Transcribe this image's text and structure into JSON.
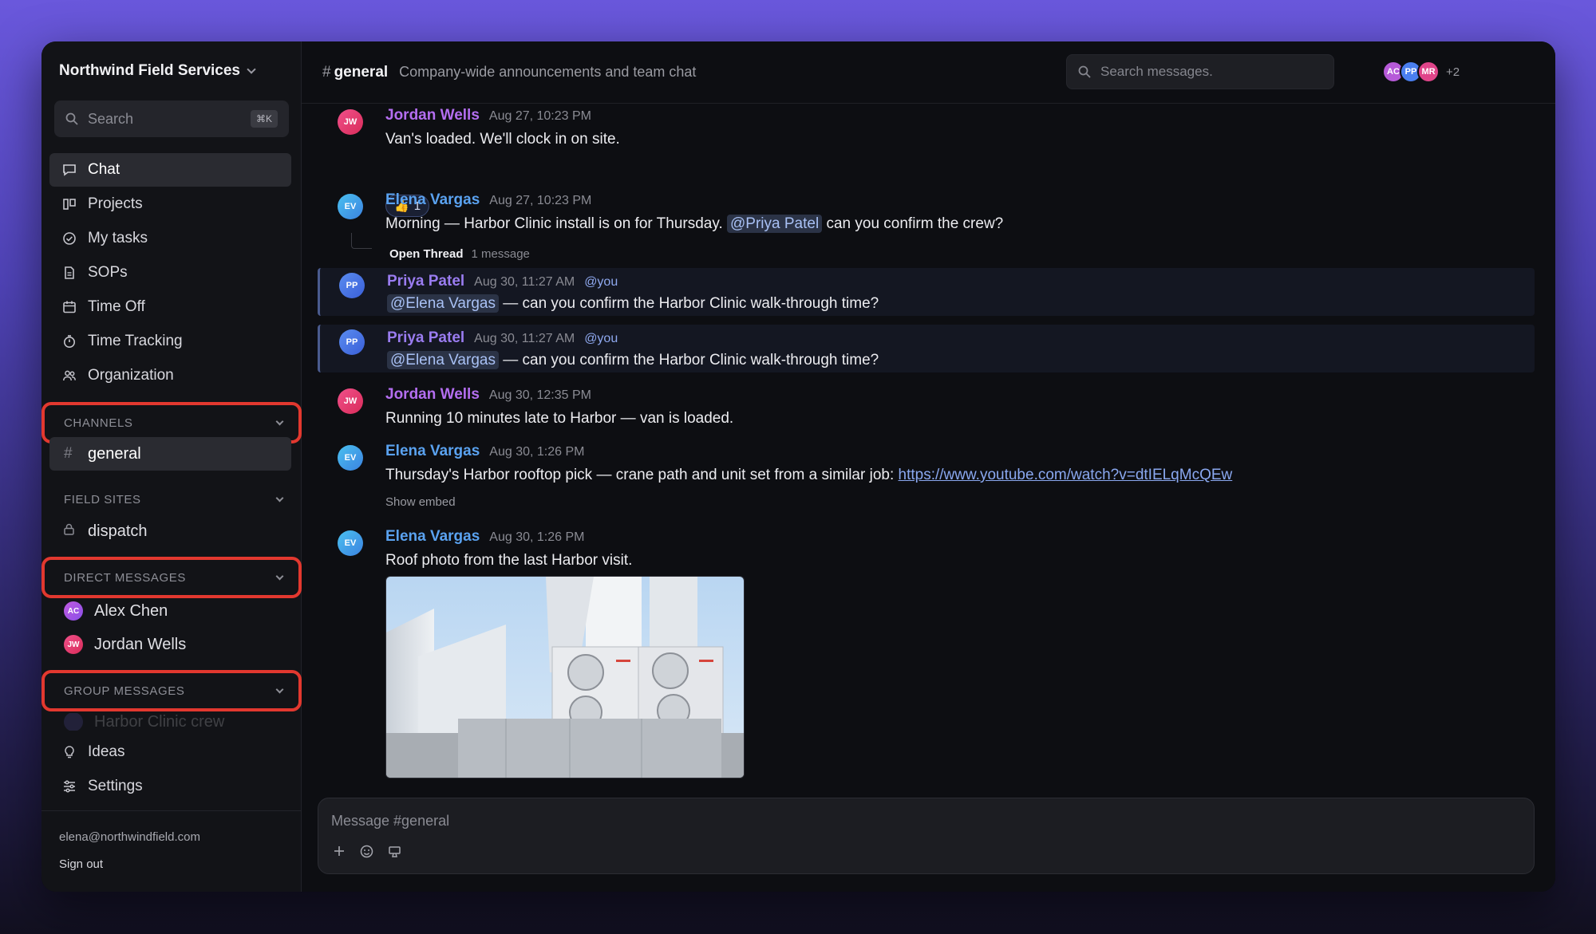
{
  "workspace": {
    "name": "Northwind Field Services"
  },
  "sidebar": {
    "search_placeholder": "Search",
    "search_shortcut": "⌘K",
    "nav": [
      {
        "label": "Chat",
        "icon": "chat-icon"
      },
      {
        "label": "Projects",
        "icon": "projects-icon"
      },
      {
        "label": "My tasks",
        "icon": "check-circle-icon"
      },
      {
        "label": "SOPs",
        "icon": "document-icon"
      },
      {
        "label": "Time Off",
        "icon": "calendar-icon"
      },
      {
        "label": "Time Tracking",
        "icon": "stopwatch-icon"
      },
      {
        "label": "Organization",
        "icon": "people-icon"
      }
    ],
    "sections": {
      "channels": "CHANNELS",
      "field_sites": "FIELD SITES",
      "direct_messages": "DIRECT MESSAGES",
      "group_messages": "GROUP MESSAGES"
    },
    "channels": [
      {
        "label": "general"
      }
    ],
    "field_sites": [
      {
        "label": "dispatch"
      }
    ],
    "direct_messages": [
      {
        "label": "Alex Chen",
        "initials": "AC"
      },
      {
        "label": "Jordan Wells",
        "initials": "JW"
      }
    ],
    "group_messages": [
      {
        "label": "Harbor Clinic crew"
      }
    ],
    "bottom_nav": [
      {
        "label": "Ideas",
        "icon": "lightbulb-icon"
      },
      {
        "label": "Settings",
        "icon": "sliders-icon"
      }
    ],
    "footer": {
      "email": "elena@northwindfield.com",
      "sign_out": "Sign out"
    }
  },
  "header": {
    "channel_hash": "#",
    "channel_name": "general",
    "channel_desc": "Company-wide announcements and team chat",
    "search_placeholder": "Search messages.",
    "members": [
      {
        "initials": "AC",
        "color": "#b65ad8"
      },
      {
        "initials": "PP",
        "color": "#4a7ff0"
      },
      {
        "initials": "MR",
        "color": "#e0458a"
      }
    ],
    "members_more": "+2",
    "help": "?"
  },
  "messages": [
    {
      "author": "Jordan Wells",
      "initials": "JW",
      "ts": "Aug 27, 10:23 PM",
      "text": "Van's loaded. We'll clock in on site.",
      "reaction_emoji": "👍",
      "reaction_count": "1"
    },
    {
      "author": "Elena Vargas",
      "initials": "EV",
      "ts": "Aug 27, 10:23 PM",
      "pre": "Morning — Harbor Clinic install is on for Thursday. ",
      "mention": "@Priya Patel",
      "post": " can you confirm the crew?",
      "thread_label": "Open Thread",
      "thread_count": "1 message"
    },
    {
      "author": "Priya Patel",
      "initials": "PP",
      "ts": "Aug 30, 11:27 AM",
      "tag": "@you",
      "mention": "@Elena Vargas",
      "post": " — can you confirm the Harbor Clinic walk-through time?"
    },
    {
      "author": "Priya Patel",
      "initials": "PP",
      "ts": "Aug 30, 11:27 AM",
      "tag": "@you",
      "mention": "@Elena Vargas",
      "post": " — can you confirm the Harbor Clinic walk-through time?"
    },
    {
      "author": "Jordan Wells",
      "initials": "JW",
      "ts": "Aug 30, 12:35 PM",
      "text": "Running 10 minutes late to Harbor — van is loaded."
    },
    {
      "author": "Elena Vargas",
      "initials": "EV",
      "ts": "Aug 30, 1:26 PM",
      "pre": "Thursday's Harbor rooftop pick — crane path and unit set from a similar job: ",
      "link": "https://www.youtube.com/watch?v=dtIELqMcQEw",
      "embed_toggle": "Show embed"
    },
    {
      "author": "Elena Vargas",
      "initials": "EV",
      "ts": "Aug 30, 1:26 PM",
      "text": "Roof photo from the last Harbor visit."
    }
  ],
  "composer": {
    "placeholder": "Message #general"
  },
  "colors": {
    "jordan": "#b46ef0",
    "elena": "#5aa2f0",
    "priya": "#9a7cf0",
    "highlight_box": "#e2382f",
    "accent_link": "#8aa8f0"
  }
}
